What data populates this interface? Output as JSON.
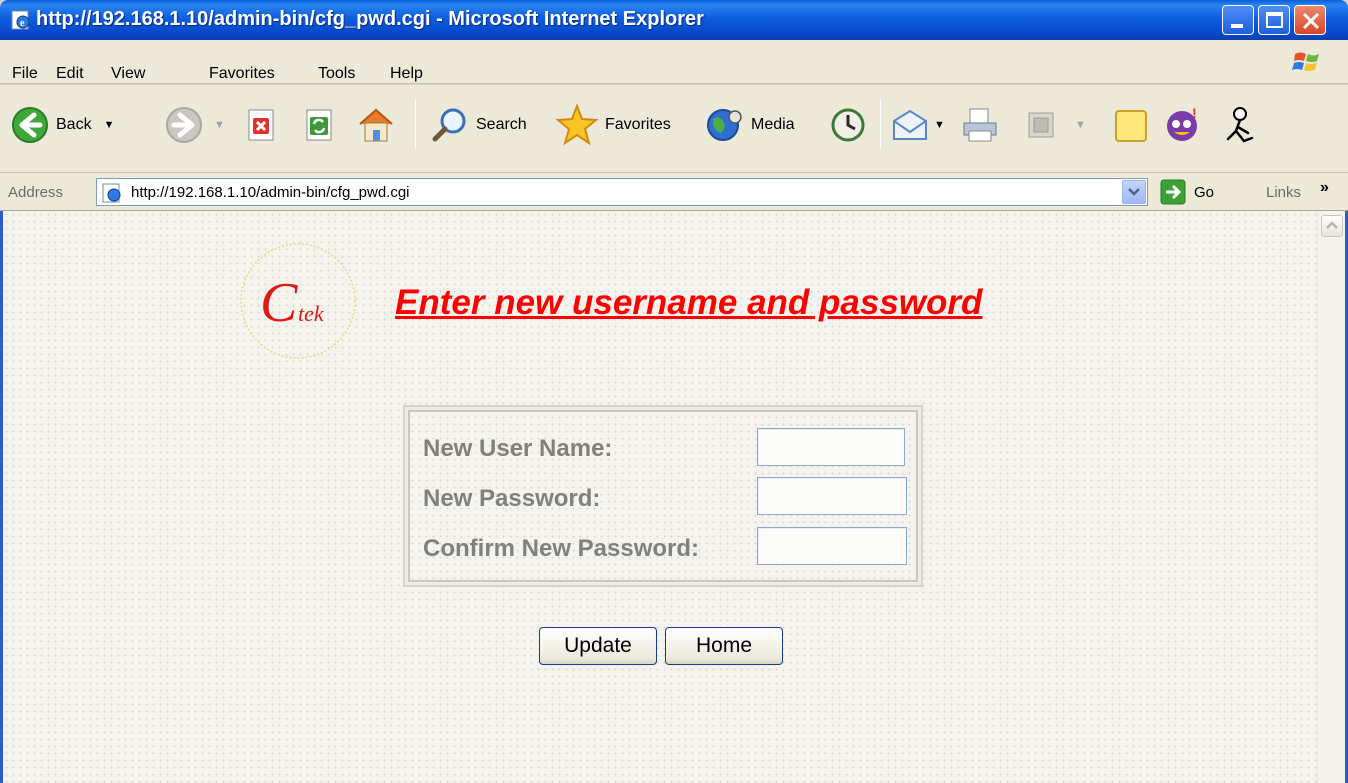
{
  "window": {
    "title": "http://192.168.1.10/admin-bin/cfg_pwd.cgi - Microsoft Internet Explorer"
  },
  "menu": [
    "File",
    "Edit",
    "View",
    "Favorites",
    "Tools",
    "Help"
  ],
  "toolbar": {
    "back_label": "Back",
    "search_label": "Search",
    "favorites_label": "Favorites",
    "media_label": "Media"
  },
  "address": {
    "label": "Address",
    "url": "http://192.168.1.10/admin-bin/cfg_pwd.cgi",
    "go_label": "Go",
    "links_label": "Links",
    "links_chevron": "»"
  },
  "page": {
    "logo_text": "C",
    "logo_sub": "tek",
    "heading": "Enter new username and password",
    "fields": [
      {
        "label": "New User Name:",
        "value": ""
      },
      {
        "label": "New Password:",
        "value": ""
      },
      {
        "label": "Confirm New Password:",
        "value": ""
      }
    ],
    "update_label": "Update",
    "home_label": "Home"
  }
}
